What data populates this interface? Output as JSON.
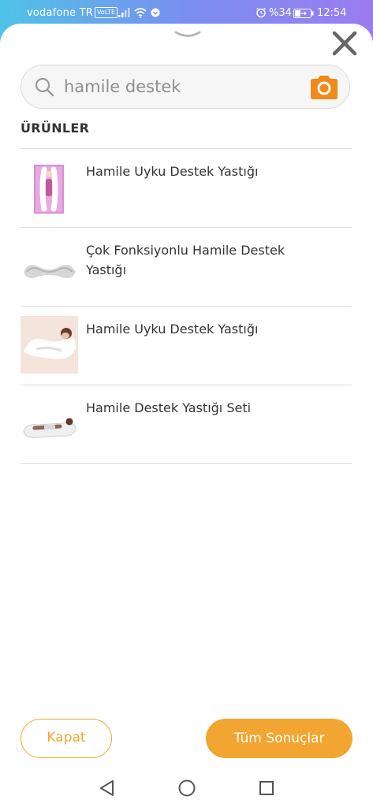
{
  "status_bar": {
    "carrier": "vodafone TR",
    "network_badge": "VoLTE",
    "battery_percent": "%34",
    "time": "12:54",
    "icons": [
      "signal-icon",
      "wifi-icon",
      "vpn-icon",
      "alarm-icon",
      "battery-icon"
    ]
  },
  "search": {
    "value": "hamile destek",
    "icon": "search-icon",
    "camera_icon": "camera-icon"
  },
  "section": {
    "title": "ÜRÜNLER"
  },
  "products": [
    {
      "title": "Hamile Uyku Destek Yastığı",
      "thumb": "product-thumbnail"
    },
    {
      "title": "Çok Fonksiyonlu Hamile Destek Yastığı",
      "thumb": "product-thumbnail"
    },
    {
      "title": "Hamile Uyku Destek Yastığı",
      "thumb": "product-thumbnail"
    },
    {
      "title": "Hamile Destek Yastığı Seti",
      "thumb": "product-thumbnail"
    }
  ],
  "actions": {
    "close_label": "Kapat",
    "all_results_label": "Tüm Sonuçlar"
  },
  "colors": {
    "accent": "#f2a530",
    "camera": "#f08a1c",
    "text": "#333333"
  }
}
